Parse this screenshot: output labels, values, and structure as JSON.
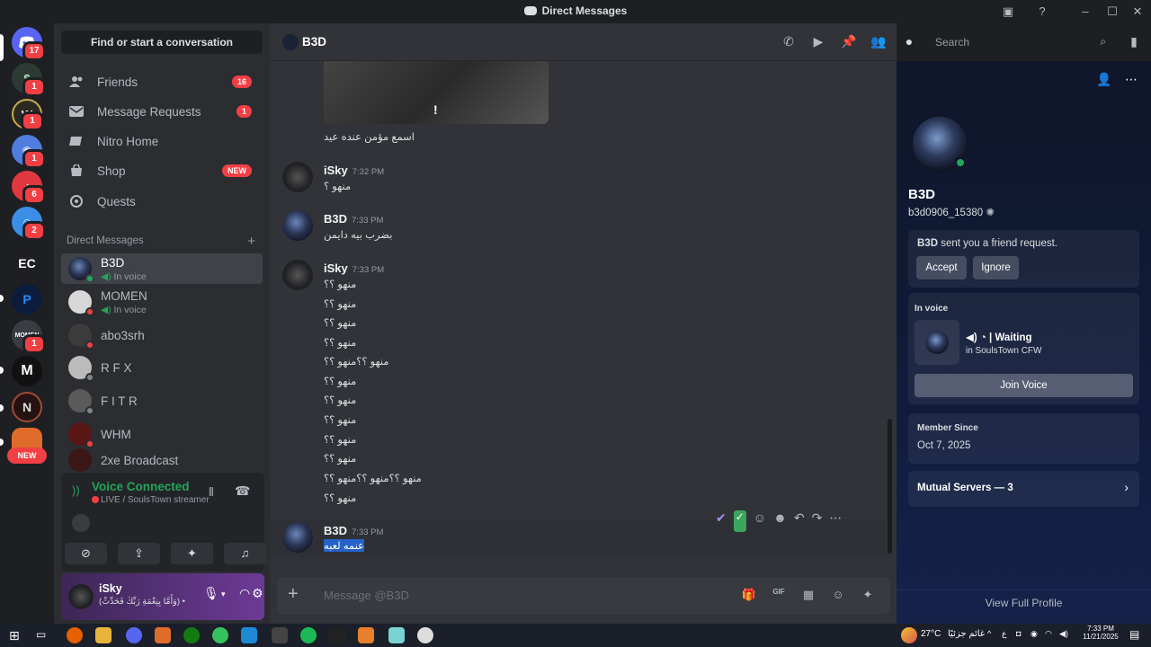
{
  "window": {
    "title": "Direct Messages"
  },
  "servers": [
    {
      "label": "",
      "badge": "17"
    },
    {
      "label": "",
      "badge": "1"
    },
    {
      "label": "",
      "badge": "1"
    },
    {
      "label": "",
      "badge": "1"
    },
    {
      "label": "",
      "badge": "6"
    },
    {
      "label": "",
      "badge": "2"
    },
    {
      "label": "EC",
      "badge": ""
    },
    {
      "label": "P",
      "badge": ""
    },
    {
      "label": "MOMEN",
      "badge": "1"
    },
    {
      "label": "M",
      "badge": ""
    },
    {
      "label": "N",
      "badge": ""
    },
    {
      "label": "NEW",
      "badge": ""
    }
  ],
  "sidebar": {
    "find_label": "Find or start a conversation",
    "nav": [
      {
        "label": "Friends",
        "badge": "16"
      },
      {
        "label": "Message Requests",
        "badge": "1"
      },
      {
        "label": "Nitro Home",
        "badge": ""
      },
      {
        "label": "Shop",
        "badge": "NEW"
      },
      {
        "label": "Quests",
        "badge": ""
      }
    ],
    "dm_header": "Direct Messages",
    "dms": [
      {
        "name": "B3D",
        "sub": "In voice"
      },
      {
        "name": "MOMEN",
        "sub": "In voice"
      },
      {
        "name": "abo3srh",
        "sub": ""
      },
      {
        "name": "R F X",
        "sub": ""
      },
      {
        "name": "F I T R",
        "sub": ""
      },
      {
        "name": "WHM",
        "sub": ""
      },
      {
        "name": "2xe Broadcast",
        "sub": ""
      }
    ],
    "voice": {
      "status": "Voice Connected",
      "channel": "LIVE / SoulsTown streamer"
    },
    "user": {
      "name": "iSky",
      "status": "(وَأَمَّا بِنِعْمَةِ رَبِّكَ فَحَدِّثْ) •"
    }
  },
  "chat": {
    "title": "B3D",
    "image_caption": "اسمع مؤمن عنده عيد",
    "image_mark": "!",
    "messages": [
      {
        "author": "iSky",
        "time": "7:32 PM",
        "lines": [
          "منهو ؟"
        ]
      },
      {
        "author": "B3D",
        "time": "7:33 PM",
        "lines": [
          "بضرب بيه دايمن"
        ]
      },
      {
        "author": "iSky",
        "time": "7:33 PM",
        "lines": [
          "منهو ؟؟",
          "منهو ؟؟",
          "منهو ؟؟",
          "منهو ؟؟",
          "منهو ؟؟منهو ؟؟",
          "منهو ؟؟",
          "منهو ؟؟",
          "منهو ؟؟",
          "منهو ؟؟",
          "منهو ؟؟",
          "منهو ؟؟منهو ؟؟منهو ؟؟",
          "منهو ؟؟"
        ]
      },
      {
        "author": "B3D",
        "time": "7:33 PM",
        "lines": [
          "عنمه لعبه"
        ]
      }
    ],
    "composer_placeholder": "Message @B3D"
  },
  "search": {
    "placeholder": "Search"
  },
  "profile": {
    "name": "B3D",
    "tag": "b3d0906_15380",
    "request": {
      "who": "B3D",
      "text": " sent you a friend request.",
      "accept": "Accept",
      "ignore": "Ignore"
    },
    "voice": {
      "label": "In voice",
      "state": "Waiting",
      "server": "in SoulsTown CFW",
      "join": "Join Voice"
    },
    "member_since": {
      "label": "Member Since",
      "date": "Oct 7, 2025"
    },
    "mutual": "Mutual Servers — 3",
    "view_full": "View Full Profile"
  },
  "taskbar": {
    "weather": "27°C",
    "weather_text": "غائم جزئيًا",
    "time": "7:33 PM",
    "date": "11/21/2025",
    "lang": "ع"
  },
  "colors": {
    "accent": "#5865f2",
    "online": "#23a55a",
    "danger": "#f23f43"
  }
}
